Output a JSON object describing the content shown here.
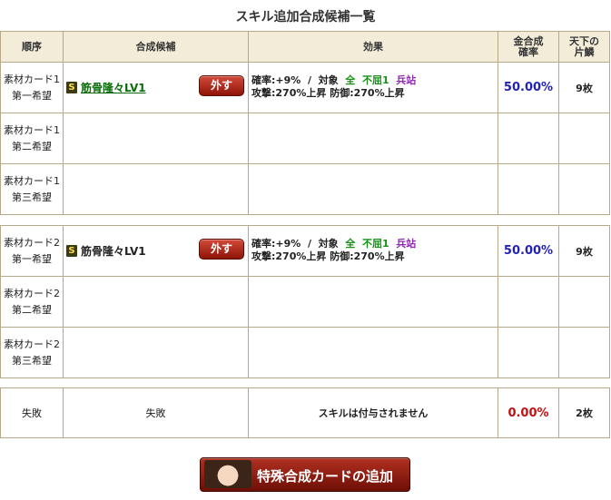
{
  "title": "スキル追加合成候補一覧",
  "headers": {
    "order": "順序",
    "candidate": "合成候補",
    "effect": "効果",
    "rate": [
      "金合成",
      "確率"
    ],
    "cost": [
      "天下の",
      "片鱗"
    ]
  },
  "groups": [
    {
      "rows": [
        {
          "order": [
            "素材カード1",
            "第一希望"
          ],
          "badge": "S",
          "skill": "筋骨隆々LV1",
          "skill_link": true,
          "remove_label": "外す",
          "effect": {
            "line1": [
              {
                "text": "確率:+9%  /  対象  ",
                "c": ""
              },
              {
                "text": "全",
                "c": "g"
              },
              {
                "text": "  ",
                "c": ""
              },
              {
                "text": "不屈1",
                "c": "g"
              },
              {
                "text": "  ",
                "c": ""
              },
              {
                "text": "兵站",
                "c": "p"
              }
            ],
            "line2": "攻撃:270%上昇 防御:270%上昇"
          },
          "rate": "50.00%",
          "cost": "9枚"
        },
        {
          "order": [
            "素材カード1",
            "第二希望"
          ]
        },
        {
          "order": [
            "素材カード1",
            "第三希望"
          ]
        }
      ]
    },
    {
      "rows": [
        {
          "order": [
            "素材カード2",
            "第一希望"
          ],
          "badge": "S",
          "skill": "筋骨隆々LV1",
          "skill_link": false,
          "remove_label": "外す",
          "effect": {
            "line1": [
              {
                "text": "確率:+9%  /  対象  ",
                "c": ""
              },
              {
                "text": "全",
                "c": "g"
              },
              {
                "text": "  ",
                "c": ""
              },
              {
                "text": "不屈1",
                "c": "g"
              },
              {
                "text": "  ",
                "c": ""
              },
              {
                "text": "兵站",
                "c": "p"
              }
            ],
            "line2": "攻撃:270%上昇 防御:270%上昇"
          },
          "rate": "50.00%",
          "cost": "9枚"
        },
        {
          "order": [
            "素材カード2",
            "第二希望"
          ]
        },
        {
          "order": [
            "素材カード2",
            "第三希望"
          ]
        }
      ]
    }
  ],
  "failure": {
    "order": "失敗",
    "candidate": "失敗",
    "effect": "スキルは付与されません",
    "rate": "0.00%",
    "cost": "2枚"
  },
  "add_button_label": "特殊合成カードの追加",
  "colors": {
    "header_bg": "#f3ecd9",
    "border": "#b7a88a",
    "rate_blue": "#2323b5",
    "rate_red": "#c41010",
    "button_red": "#8e1408"
  }
}
